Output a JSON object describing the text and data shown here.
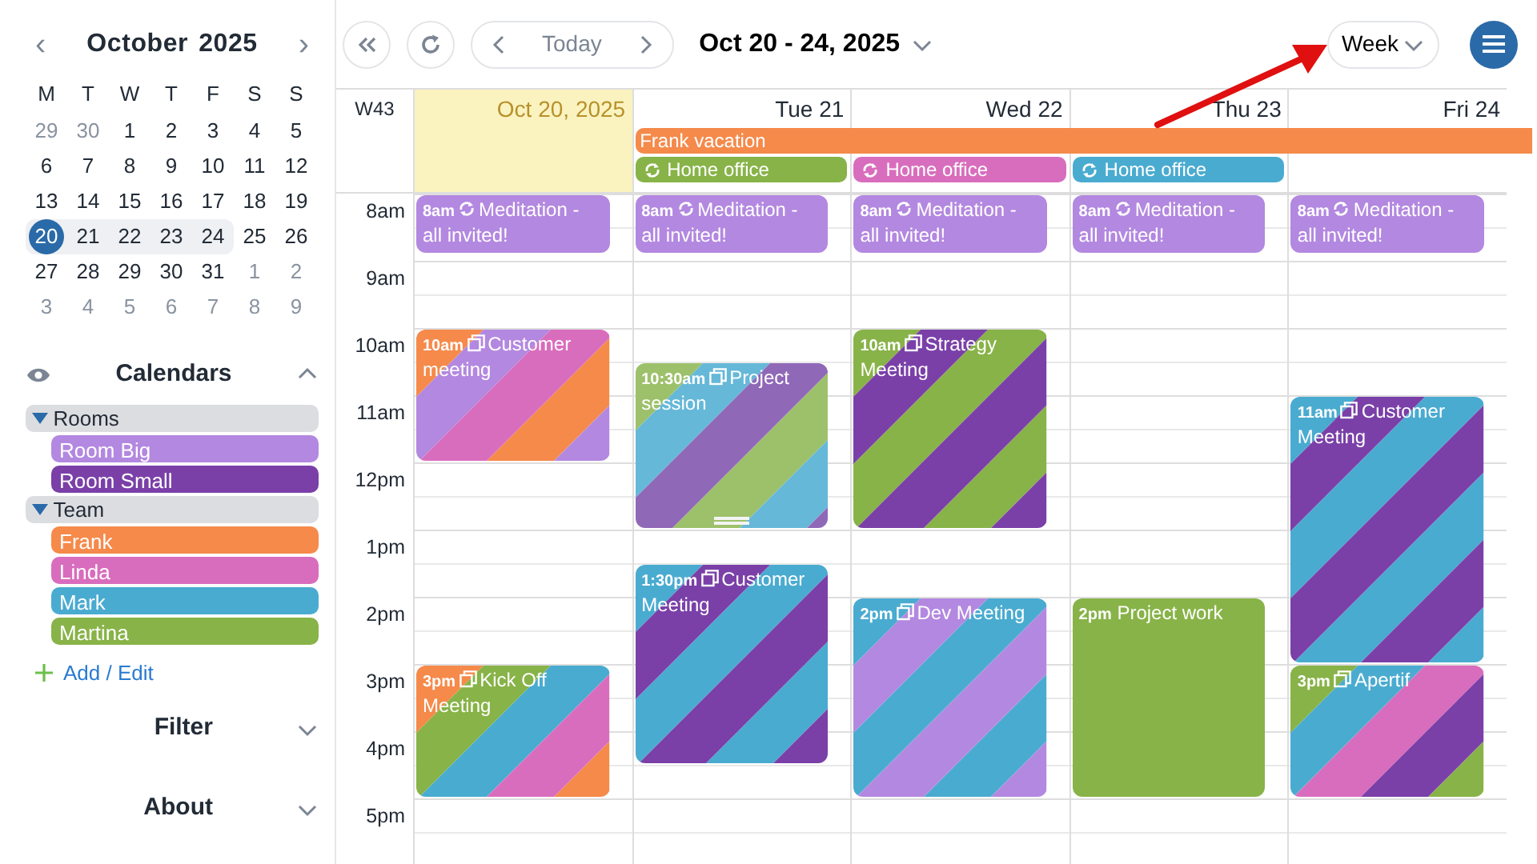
{
  "mini_calendar": {
    "month": "October",
    "year": "2025",
    "prev": "‹",
    "next": "›",
    "weekdays": [
      "M",
      "T",
      "W",
      "T",
      "F",
      "S",
      "S"
    ],
    "weeks": [
      [
        {
          "d": "29",
          "muted": true,
          "selected": false,
          "in_range": false
        },
        {
          "d": "30",
          "muted": true,
          "selected": false,
          "in_range": false
        },
        {
          "d": "1",
          "muted": false,
          "selected": false,
          "in_range": false
        },
        {
          "d": "2",
          "muted": false,
          "selected": false,
          "in_range": false
        },
        {
          "d": "3",
          "muted": false,
          "selected": false,
          "in_range": false
        },
        {
          "d": "4",
          "muted": false,
          "selected": false,
          "in_range": false
        },
        {
          "d": "5",
          "muted": false,
          "selected": false,
          "in_range": false
        }
      ],
      [
        {
          "d": "6",
          "muted": false,
          "selected": false,
          "in_range": false
        },
        {
          "d": "7",
          "muted": false,
          "selected": false,
          "in_range": false
        },
        {
          "d": "8",
          "muted": false,
          "selected": false,
          "in_range": false
        },
        {
          "d": "9",
          "muted": false,
          "selected": false,
          "in_range": false
        },
        {
          "d": "10",
          "muted": false,
          "selected": false,
          "in_range": false
        },
        {
          "d": "11",
          "muted": false,
          "selected": false,
          "in_range": false
        },
        {
          "d": "12",
          "muted": false,
          "selected": false,
          "in_range": false
        }
      ],
      [
        {
          "d": "13",
          "muted": false,
          "selected": false,
          "in_range": false
        },
        {
          "d": "14",
          "muted": false,
          "selected": false,
          "in_range": false
        },
        {
          "d": "15",
          "muted": false,
          "selected": false,
          "in_range": false
        },
        {
          "d": "16",
          "muted": false,
          "selected": false,
          "in_range": false
        },
        {
          "d": "17",
          "muted": false,
          "selected": false,
          "in_range": false
        },
        {
          "d": "18",
          "muted": false,
          "selected": false,
          "in_range": false
        },
        {
          "d": "19",
          "muted": false,
          "selected": false,
          "in_range": false
        }
      ],
      [
        {
          "d": "20",
          "muted": false,
          "selected": true,
          "in_range": true
        },
        {
          "d": "21",
          "muted": false,
          "selected": false,
          "in_range": true
        },
        {
          "d": "22",
          "muted": false,
          "selected": false,
          "in_range": true
        },
        {
          "d": "23",
          "muted": false,
          "selected": false,
          "in_range": true
        },
        {
          "d": "24",
          "muted": false,
          "selected": false,
          "in_range": true
        },
        {
          "d": "25",
          "muted": false,
          "selected": false,
          "in_range": false
        },
        {
          "d": "26",
          "muted": false,
          "selected": false,
          "in_range": false
        }
      ],
      [
        {
          "d": "27",
          "muted": false,
          "selected": false,
          "in_range": false
        },
        {
          "d": "28",
          "muted": false,
          "selected": false,
          "in_range": false
        },
        {
          "d": "29",
          "muted": false,
          "selected": false,
          "in_range": false
        },
        {
          "d": "30",
          "muted": false,
          "selected": false,
          "in_range": false
        },
        {
          "d": "31",
          "muted": false,
          "selected": false,
          "in_range": false
        },
        {
          "d": "1",
          "muted": true,
          "selected": false,
          "in_range": false
        },
        {
          "d": "2",
          "muted": true,
          "selected": false,
          "in_range": false
        }
      ],
      [
        {
          "d": "3",
          "muted": true,
          "selected": false,
          "in_range": false
        },
        {
          "d": "4",
          "muted": true,
          "selected": false,
          "in_range": false
        },
        {
          "d": "5",
          "muted": true,
          "selected": false,
          "in_range": false
        },
        {
          "d": "6",
          "muted": true,
          "selected": false,
          "in_range": false
        },
        {
          "d": "7",
          "muted": true,
          "selected": false,
          "in_range": false
        },
        {
          "d": "8",
          "muted": true,
          "selected": false,
          "in_range": false
        },
        {
          "d": "9",
          "muted": true,
          "selected": false,
          "in_range": false
        }
      ]
    ]
  },
  "calendars": {
    "title": "Calendars",
    "expanded": true,
    "groups": [
      {
        "name": "Rooms",
        "expanded": true,
        "children": [
          {
            "name": "Room Big",
            "color": "#b388e0"
          },
          {
            "name": "Room Small",
            "color": "#7a40a8"
          }
        ]
      },
      {
        "name": "Team",
        "expanded": true,
        "children": [
          {
            "name": "Frank",
            "color": "#f58a4b"
          },
          {
            "name": "Linda",
            "color": "#d96dbd"
          },
          {
            "name": "Mark",
            "color": "#4aabd0"
          },
          {
            "name": "Martina",
            "color": "#88b348"
          }
        ]
      }
    ],
    "add_link": "Add / Edit"
  },
  "sections": [
    {
      "title": "Filter",
      "expanded": false
    },
    {
      "title": "About",
      "expanded": false
    }
  ],
  "toolbar": {
    "today": "Today",
    "range": "Oct 20 - 24, 2025",
    "view": "Week"
  },
  "week_label": "W43",
  "hours": [
    "8am",
    "9am",
    "10am",
    "11am",
    "12pm",
    "1pm",
    "2pm",
    "3pm",
    "4pm",
    "5pm"
  ],
  "all_day_rows": [
    [
      {
        "kind": "gap"
      },
      {
        "title": "Frank vacation",
        "kind": "bar",
        "color": "#f58a4b"
      }
    ],
    [
      {
        "kind": "gap"
      },
      {
        "title": "Home office",
        "kind": "recurring",
        "color": "#88b348"
      },
      {
        "title": "Home office",
        "kind": "recurring",
        "color": "#d96dbd"
      },
      {
        "title": "Home office",
        "kind": "recurring",
        "color": "#4aabd0"
      }
    ]
  ],
  "days": [
    {
      "label": "Oct 20, 2025",
      "today": true,
      "cells": [
        {
          "kind": "recurring",
          "time": "8am",
          "title": "Meditation - all invited!",
          "color": "#b388e0",
          "selected": false
        },
        {
          "kind": "more"
        },
        {
          "kind": "free"
        },
        {
          "kind": "free"
        },
        {
          "kind": "series",
          "time": "10am",
          "title": "Customer meeting",
          "stripes": [
            {
              "color": "#f58a4b"
            },
            {
              "color": "#b388e0"
            },
            {
              "color": "#d96dbd"
            }
          ],
          "selected": false
        },
        {
          "kind": "more"
        },
        {
          "kind": "more"
        },
        {
          "kind": "more"
        },
        {
          "kind": "free"
        },
        {
          "kind": "free"
        },
        {
          "kind": "free"
        },
        {
          "kind": "free"
        },
        {
          "kind": "free"
        },
        {
          "kind": "free"
        },
        {
          "kind": "series",
          "time": "3pm",
          "title": "Kick Off Meeting",
          "stripes": [
            {
              "color": "#f58a4b"
            },
            {
              "color": "#88b348"
            },
            {
              "color": "#4aabd0"
            },
            {
              "color": "#d96dbd"
            }
          ],
          "selected": false
        },
        {
          "kind": "more"
        },
        {
          "kind": "more"
        },
        {
          "kind": "more"
        },
        {
          "kind": "free"
        },
        {
          "kind": "free"
        }
      ]
    },
    {
      "label": "Tue 21",
      "today": false,
      "cells": [
        {
          "kind": "recurring",
          "time": "8am",
          "title": "Meditation - all invited!",
          "color": "#b388e0",
          "selected": false
        },
        {
          "kind": "more"
        },
        {
          "kind": "free"
        },
        {
          "kind": "free"
        },
        {
          "kind": "free"
        },
        {
          "kind": "series",
          "time": "10:30am",
          "title": "Project session",
          "stripes": [
            {
              "color": "#9dc16b"
            },
            {
              "color": "#66b8d8"
            },
            {
              "color": "#9068b8"
            }
          ],
          "selected": true
        },
        {
          "kind": "more"
        },
        {
          "kind": "more"
        },
        {
          "kind": "more"
        },
        {
          "kind": "more"
        },
        {
          "kind": "free"
        },
        {
          "kind": "series",
          "time": "1:30pm",
          "title": "Customer Meeting",
          "stripes": [
            {
              "color": "#4aabd0"
            },
            {
              "color": "#7a40a8"
            }
          ],
          "selected": false
        },
        {
          "kind": "more"
        },
        {
          "kind": "more"
        },
        {
          "kind": "more"
        },
        {
          "kind": "more"
        },
        {
          "kind": "more"
        },
        {
          "kind": "free"
        },
        {
          "kind": "free"
        },
        {
          "kind": "free"
        }
      ]
    },
    {
      "label": "Wed 22",
      "today": false,
      "cells": [
        {
          "kind": "recurring",
          "time": "8am",
          "title": "Meditation - all invited!",
          "color": "#b388e0",
          "selected": false
        },
        {
          "kind": "more"
        },
        {
          "kind": "free"
        },
        {
          "kind": "free"
        },
        {
          "kind": "series",
          "time": "10am",
          "title": "Strategy Meeting",
          "stripes": [
            {
              "color": "#88b348"
            },
            {
              "color": "#7a40a8"
            }
          ],
          "selected": false
        },
        {
          "kind": "more"
        },
        {
          "kind": "more"
        },
        {
          "kind": "more"
        },
        {
          "kind": "more"
        },
        {
          "kind": "more"
        },
        {
          "kind": "free"
        },
        {
          "kind": "free"
        },
        {
          "kind": "series",
          "time": "2pm",
          "title": "Dev Meeting",
          "stripes": [
            {
              "color": "#4aabd0"
            },
            {
              "color": "#b388e0"
            }
          ],
          "selected": false
        },
        {
          "kind": "more"
        },
        {
          "kind": "more"
        },
        {
          "kind": "more"
        },
        {
          "kind": "more"
        },
        {
          "kind": "more"
        },
        {
          "kind": "free"
        },
        {
          "kind": "free"
        }
      ]
    },
    {
      "label": "Thu 23",
      "today": false,
      "cells": [
        {
          "kind": "recurring",
          "time": "8am",
          "title": "Meditation - all invited!",
          "color": "#b388e0",
          "selected": false
        },
        {
          "kind": "more"
        },
        {
          "kind": "free"
        },
        {
          "kind": "free"
        },
        {
          "kind": "free"
        },
        {
          "kind": "free"
        },
        {
          "kind": "free"
        },
        {
          "kind": "free"
        },
        {
          "kind": "free"
        },
        {
          "kind": "free"
        },
        {
          "kind": "free"
        },
        {
          "kind": "free"
        },
        {
          "kind": "single",
          "time": "2pm",
          "title": "Project work",
          "color": "#88b348",
          "selected": false
        },
        {
          "kind": "more"
        },
        {
          "kind": "more"
        },
        {
          "kind": "more"
        },
        {
          "kind": "more"
        },
        {
          "kind": "more"
        },
        {
          "kind": "free"
        },
        {
          "kind": "free"
        }
      ]
    },
    {
      "label": "Fri 24",
      "today": false,
      "cells": [
        {
          "kind": "recurring",
          "time": "8am",
          "title": "Meditation - all invited!",
          "color": "#b388e0",
          "selected": false
        },
        {
          "kind": "more"
        },
        {
          "kind": "free"
        },
        {
          "kind": "free"
        },
        {
          "kind": "free"
        },
        {
          "kind": "free"
        },
        {
          "kind": "series",
          "time": "11am",
          "title": "Customer Meeting",
          "stripes": [
            {
              "color": "#4aabd0"
            },
            {
              "color": "#7a40a8"
            }
          ],
          "selected": false
        },
        {
          "kind": "more"
        },
        {
          "kind": "more"
        },
        {
          "kind": "more"
        },
        {
          "kind": "more"
        },
        {
          "kind": "more"
        },
        {
          "kind": "more"
        },
        {
          "kind": "more"
        },
        {
          "kind": "series",
          "time": "3pm",
          "title": "Apertif",
          "stripes": [
            {
              "color": "#88b348"
            },
            {
              "color": "#4aabd0"
            },
            {
              "color": "#d96dbd"
            },
            {
              "color": "#7a40a8"
            }
          ],
          "selected": false
        },
        {
          "kind": "more"
        },
        {
          "kind": "more"
        },
        {
          "kind": "more"
        },
        {
          "kind": "free"
        },
        {
          "kind": "free"
        }
      ]
    }
  ]
}
